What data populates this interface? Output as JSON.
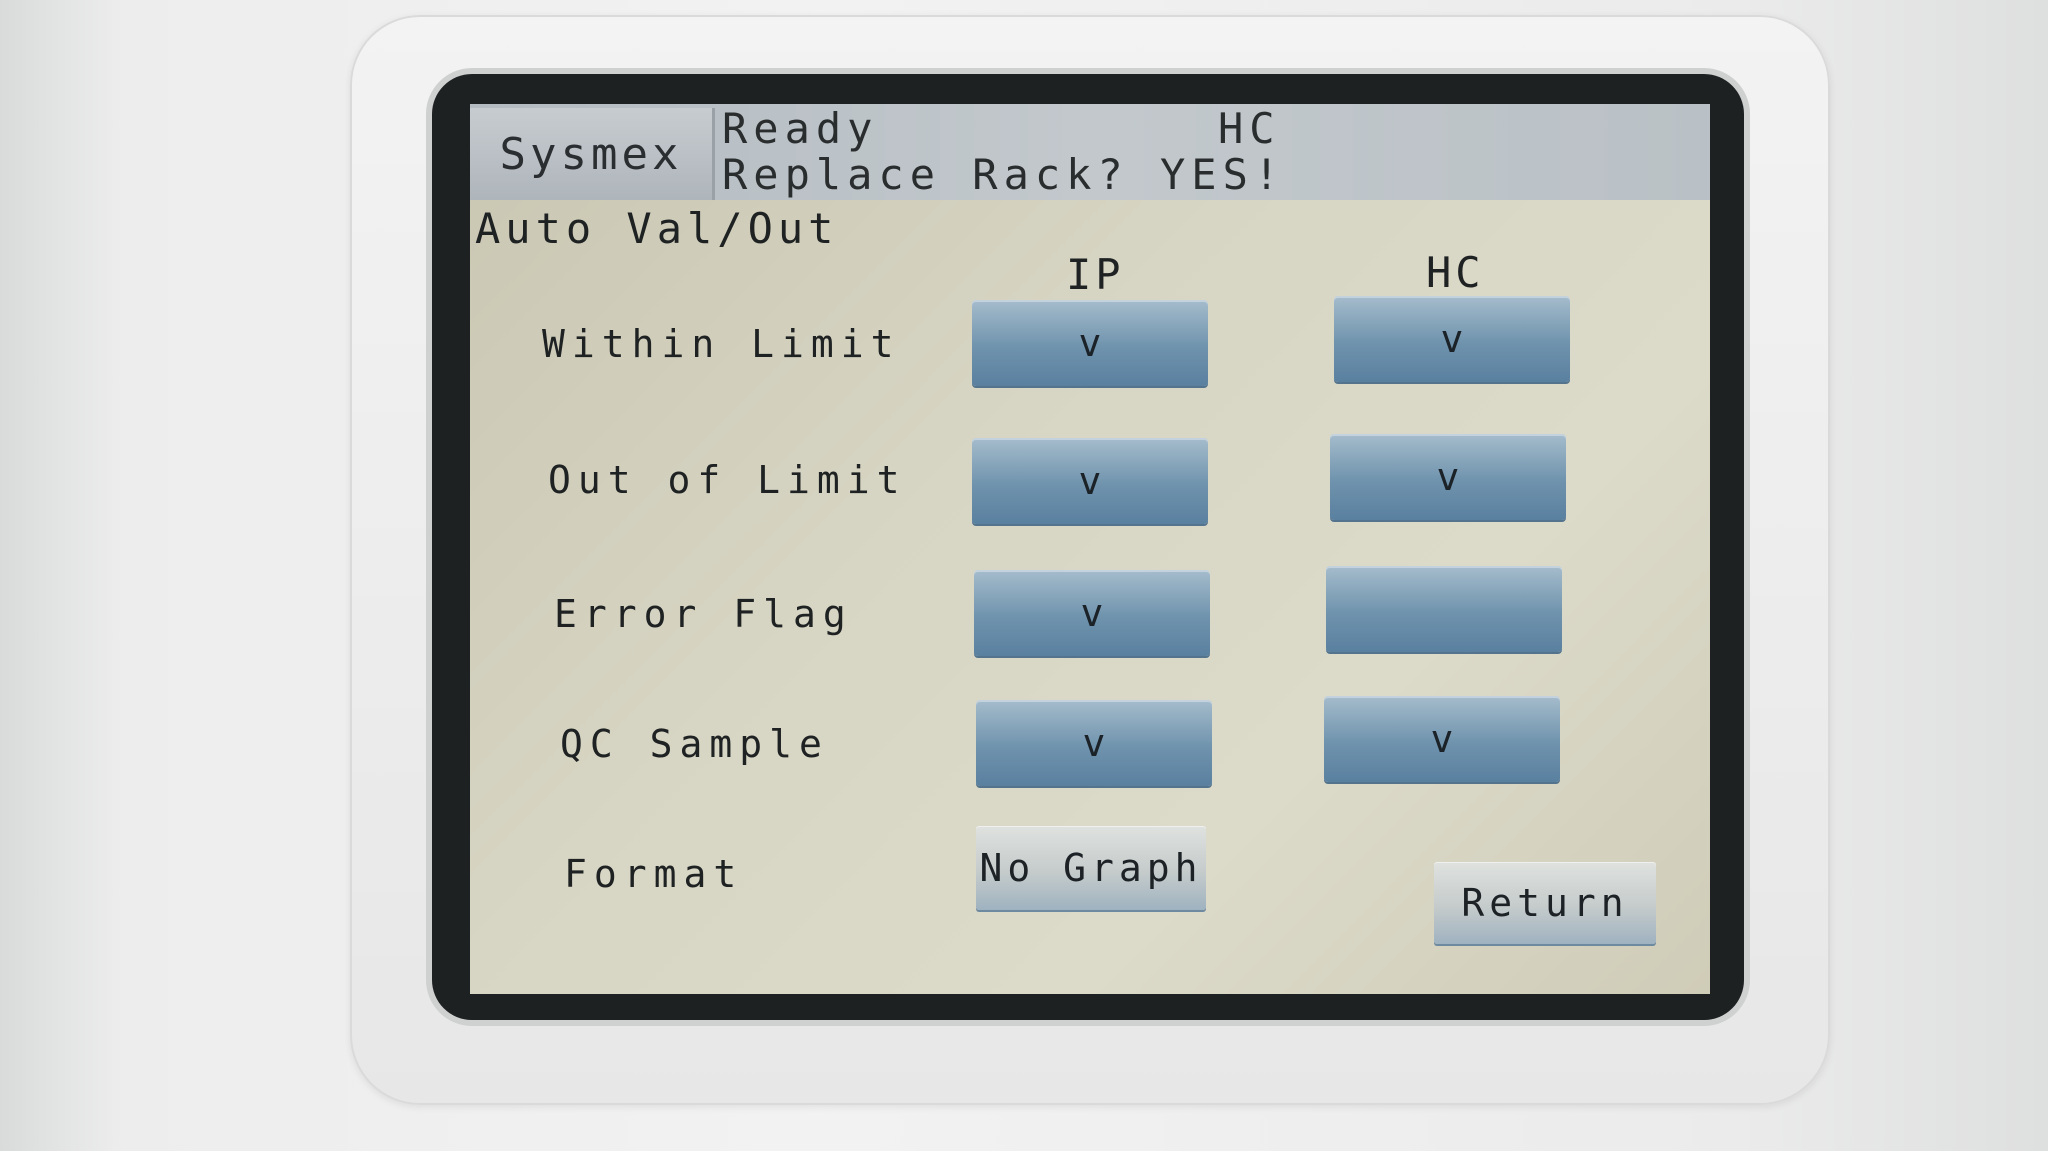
{
  "header": {
    "brand": "Sysmex",
    "status_line1": "Ready",
    "status_mode": "HC",
    "status_line2": "Replace Rack? YES!"
  },
  "screen": {
    "title": "Auto Val/Out",
    "columns": [
      "IP",
      "HC"
    ],
    "rows": [
      {
        "label": "Within Limit",
        "ip": "v",
        "hc": "v"
      },
      {
        "label": "Out of Limit",
        "ip": "v",
        "hc": "v"
      },
      {
        "label": "Error Flag",
        "ip": "v",
        "hc": ""
      },
      {
        "label": "QC Sample",
        "ip": "v",
        "hc": "v"
      }
    ],
    "format_label": "Format",
    "format_value": "No Graph",
    "return_label": "Return"
  }
}
